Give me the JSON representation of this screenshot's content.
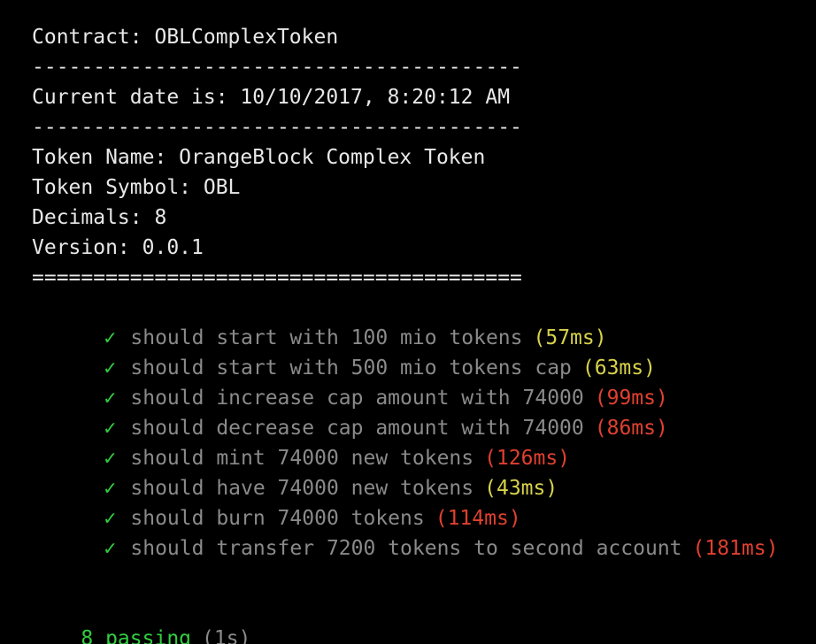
{
  "header": {
    "contract_line": "Contract: OBLComplexToken",
    "separator_1": "----------------------------------------",
    "date_line": "Current date is: 10/10/2017, 8:20:12 AM",
    "separator_2": "----------------------------------------",
    "token_name_line": "Token Name: OrangeBlock Complex Token",
    "token_symbol_line": "Token Symbol: OBL",
    "decimals_line": "Decimals: 8",
    "version_line": "Version: 0.0.1",
    "separator_3": "========================================"
  },
  "tests": [
    {
      "check": "✓",
      "title": "should start with 100 mio tokens",
      "duration": "(57ms)",
      "speed": "medium"
    },
    {
      "check": "✓",
      "title": "should start with 500 mio tokens cap",
      "duration": "(63ms)",
      "speed": "medium"
    },
    {
      "check": "✓",
      "title": "should increase cap amount with 74000",
      "duration": "(99ms)",
      "speed": "slow"
    },
    {
      "check": "✓",
      "title": "should decrease cap amount with 74000",
      "duration": "(86ms)",
      "speed": "slow"
    },
    {
      "check": "✓",
      "title": "should mint 74000 new tokens",
      "duration": "(126ms)",
      "speed": "slow"
    },
    {
      "check": "✓",
      "title": "should have 74000 new tokens",
      "duration": "(43ms)",
      "speed": "medium"
    },
    {
      "check": "✓",
      "title": "should burn 74000 tokens",
      "duration": "(114ms)",
      "speed": "slow"
    },
    {
      "check": "✓",
      "title": "should transfer 7200 tokens to second account",
      "duration": "(181ms)",
      "speed": "slow"
    }
  ],
  "summary": {
    "passing": "8 passing",
    "time": "(1s)"
  },
  "colors": {
    "background": "#000000",
    "text": "#e8e8e8",
    "pass_green": "#2fcf3f",
    "muted_gray": "#8a8a8a",
    "medium_yellow": "#d7d24a",
    "slow_red": "#e0402f"
  }
}
